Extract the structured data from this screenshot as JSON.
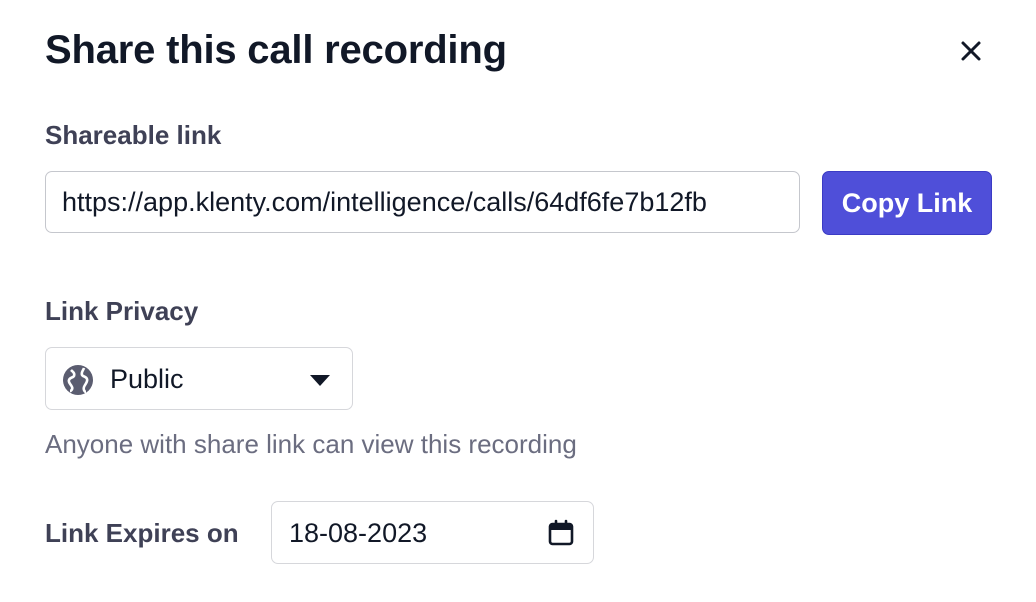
{
  "dialog": {
    "title": "Share this call recording"
  },
  "shareable_link": {
    "label": "Shareable link",
    "value": "https://app.klenty.com/intelligence/calls/64df6fe7b12fb",
    "copy_button_label": "Copy Link"
  },
  "privacy": {
    "label": "Link Privacy",
    "selected": "Public",
    "icon": "globe-icon",
    "helper_text": "Anyone with share link can view this recording"
  },
  "expiry": {
    "label": "Link Expires on",
    "date": "18-08-2023",
    "icon": "calendar-icon"
  },
  "colors": {
    "accent": "#4f4fd9",
    "label_text": "#3f4156",
    "helper_text": "#6b6d80"
  }
}
